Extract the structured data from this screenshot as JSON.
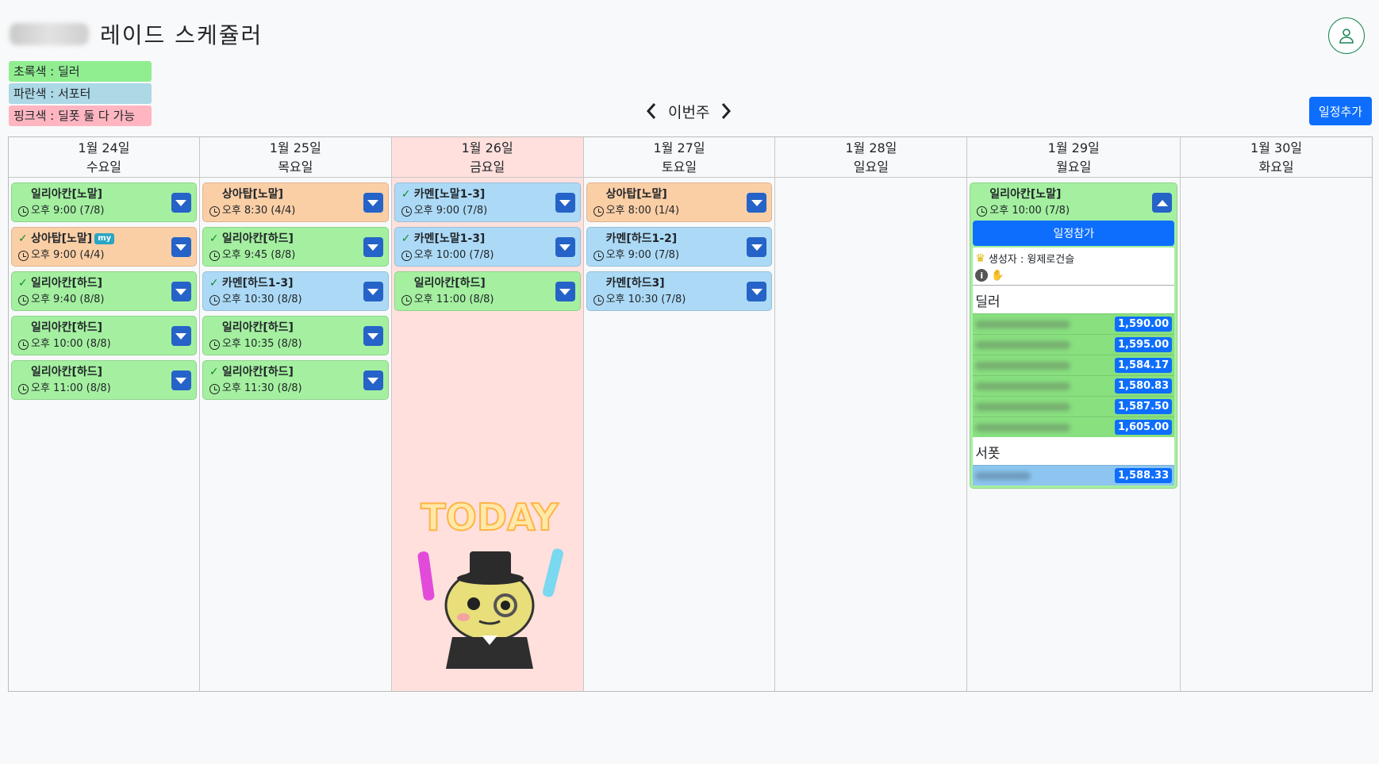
{
  "header": {
    "title": "레이드  스케쥴러"
  },
  "legend": [
    {
      "label": "초록색 : 딜러",
      "color": "#90ee90"
    },
    {
      "label": "파란색 : 서포터",
      "color": "#add8e6"
    },
    {
      "label": "핑크색 : 딜폿 둘 다 가능",
      "color": "#ffb6c1"
    }
  ],
  "nav": {
    "week_label": "이번주"
  },
  "toolbar": {
    "add_label": "일정추가"
  },
  "sticker": {
    "text": "TODAY"
  },
  "days": [
    {
      "date": "1월 24일",
      "weekday": "수요일",
      "today": false,
      "events": [
        {
          "title": "일리아칸[노말]",
          "time": "오후 9:00 (7/8)",
          "color": "green",
          "checked": false,
          "my": false
        },
        {
          "title": "상아탑[노말]",
          "time": "오후 9:00 (4/4)",
          "color": "peach",
          "checked": true,
          "my": true,
          "my_label": "my"
        },
        {
          "title": "일리아칸[하드]",
          "time": "오후 9:40 (8/8)",
          "color": "green",
          "checked": true,
          "my": false
        },
        {
          "title": "일리아칸[하드]",
          "time": "오후 10:00 (8/8)",
          "color": "green",
          "checked": false,
          "my": false
        },
        {
          "title": "일리아칸[하드]",
          "time": "오후 11:00 (8/8)",
          "color": "green",
          "checked": false,
          "my": false
        }
      ]
    },
    {
      "date": "1월 25일",
      "weekday": "목요일",
      "today": false,
      "events": [
        {
          "title": "상아탑[노말]",
          "time": "오후 8:30 (4/4)",
          "color": "peach",
          "checked": false,
          "my": false
        },
        {
          "title": "일리아칸[하드]",
          "time": "오후 9:45 (8/8)",
          "color": "green",
          "checked": true,
          "my": false
        },
        {
          "title": "카멘[하드1-3]",
          "time": "오후 10:30 (8/8)",
          "color": "blue",
          "checked": true,
          "my": false
        },
        {
          "title": "일리아칸[하드]",
          "time": "오후 10:35 (8/8)",
          "color": "green",
          "checked": false,
          "my": false
        },
        {
          "title": "일리아칸[하드]",
          "time": "오후 11:30 (8/8)",
          "color": "green",
          "checked": true,
          "my": false
        }
      ]
    },
    {
      "date": "1월 26일",
      "weekday": "금요일",
      "today": true,
      "events": [
        {
          "title": "카멘[노말1-3]",
          "time": "오후 9:00 (7/8)",
          "color": "blue",
          "checked": true,
          "my": false
        },
        {
          "title": "카멘[노말1-3]",
          "time": "오후 10:00 (7/8)",
          "color": "blue",
          "checked": true,
          "my": false
        },
        {
          "title": "일리아칸[하드]",
          "time": "오후 11:00 (8/8)",
          "color": "green",
          "checked": false,
          "my": false
        }
      ]
    },
    {
      "date": "1월 27일",
      "weekday": "토요일",
      "today": false,
      "events": [
        {
          "title": "상아탑[노말]",
          "time": "오후 8:00 (1/4)",
          "color": "peach",
          "checked": false,
          "my": false
        },
        {
          "title": "카멘[하드1-2]",
          "time": "오후 9:00 (7/8)",
          "color": "blue",
          "checked": false,
          "my": false
        },
        {
          "title": "카멘[하드3]",
          "time": "오후 10:30 (7/8)",
          "color": "blue",
          "checked": false,
          "my": false
        }
      ]
    },
    {
      "date": "1월 28일",
      "weekday": "일요일",
      "today": false,
      "events": []
    },
    {
      "date": "1월 29일",
      "weekday": "월요일",
      "today": false,
      "expanded": {
        "title": "일리아칸[노말]",
        "time": "오후 10:00 (7/8)",
        "join_label": "일정참가",
        "creator": "생성자 : 윙제로건슬",
        "dealer_label": "딜러",
        "support_label": "서폿",
        "dealers": [
          "1,590.00",
          "1,595.00",
          "1,584.17",
          "1,580.83",
          "1,587.50",
          "1,605.00"
        ],
        "supports": [
          "1,588.33"
        ]
      },
      "events": []
    },
    {
      "date": "1월 30일",
      "weekday": "화요일",
      "today": false,
      "events": []
    }
  ]
}
